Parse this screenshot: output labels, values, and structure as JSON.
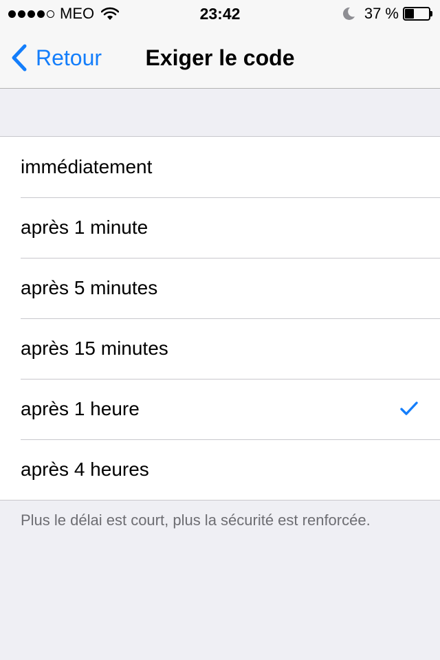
{
  "status_bar": {
    "carrier": "MEO",
    "signal_bars_filled": 4,
    "signal_bars_total": 5,
    "time": "23:42",
    "battery_text": "37 %",
    "battery_level": 0.37,
    "icons": [
      "signal-dots",
      "wifi-icon",
      "moon-icon",
      "battery-icon"
    ]
  },
  "nav": {
    "back_label": "Retour",
    "title": "Exiger le code"
  },
  "options": [
    {
      "label": "immédiatement",
      "selected": false
    },
    {
      "label": "après 1 minute",
      "selected": false
    },
    {
      "label": "après 5 minutes",
      "selected": false
    },
    {
      "label": "après 15 minutes",
      "selected": false
    },
    {
      "label": "après 1 heure",
      "selected": true
    },
    {
      "label": "après 4 heures",
      "selected": false
    }
  ],
  "footer_note": "Plus le délai est court, plus la sécurité est renforcée.",
  "colors": {
    "accent": "#147efb",
    "background": "#efeff4",
    "bar_background": "#f7f7f7",
    "separator": "#c8c7cc",
    "footer_text": "#6d6d72"
  }
}
